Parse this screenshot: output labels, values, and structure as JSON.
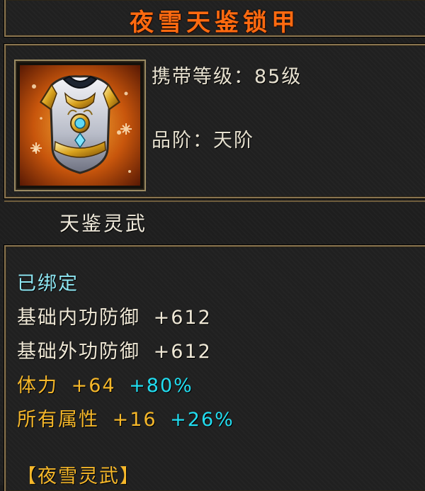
{
  "item": {
    "name": "夜雪天鉴锁甲",
    "level_label": "携带等级：85级",
    "grade_label": "品阶：天阶",
    "set_category": "天鉴灵武",
    "icon": "armor-vest-icon"
  },
  "attributes": {
    "bound": "已绑定",
    "internal_def_name": "基础内功防御",
    "internal_def_value": "+612",
    "external_def_name": "基础外功防御",
    "external_def_value": "+612",
    "stamina_name": "体力",
    "stamina_value": "+64",
    "stamina_bonus": "+80%",
    "all_attr_name": "所有属性",
    "all_attr_value": "+16",
    "all_attr_bonus": "+26%"
  },
  "set_name": "【夜雪灵武】",
  "colors": {
    "title": "#ff6a10",
    "bound": "#8ee6f2",
    "gold": "#f5b72a",
    "cyan": "#22ddf0",
    "border": "#8a7550"
  }
}
